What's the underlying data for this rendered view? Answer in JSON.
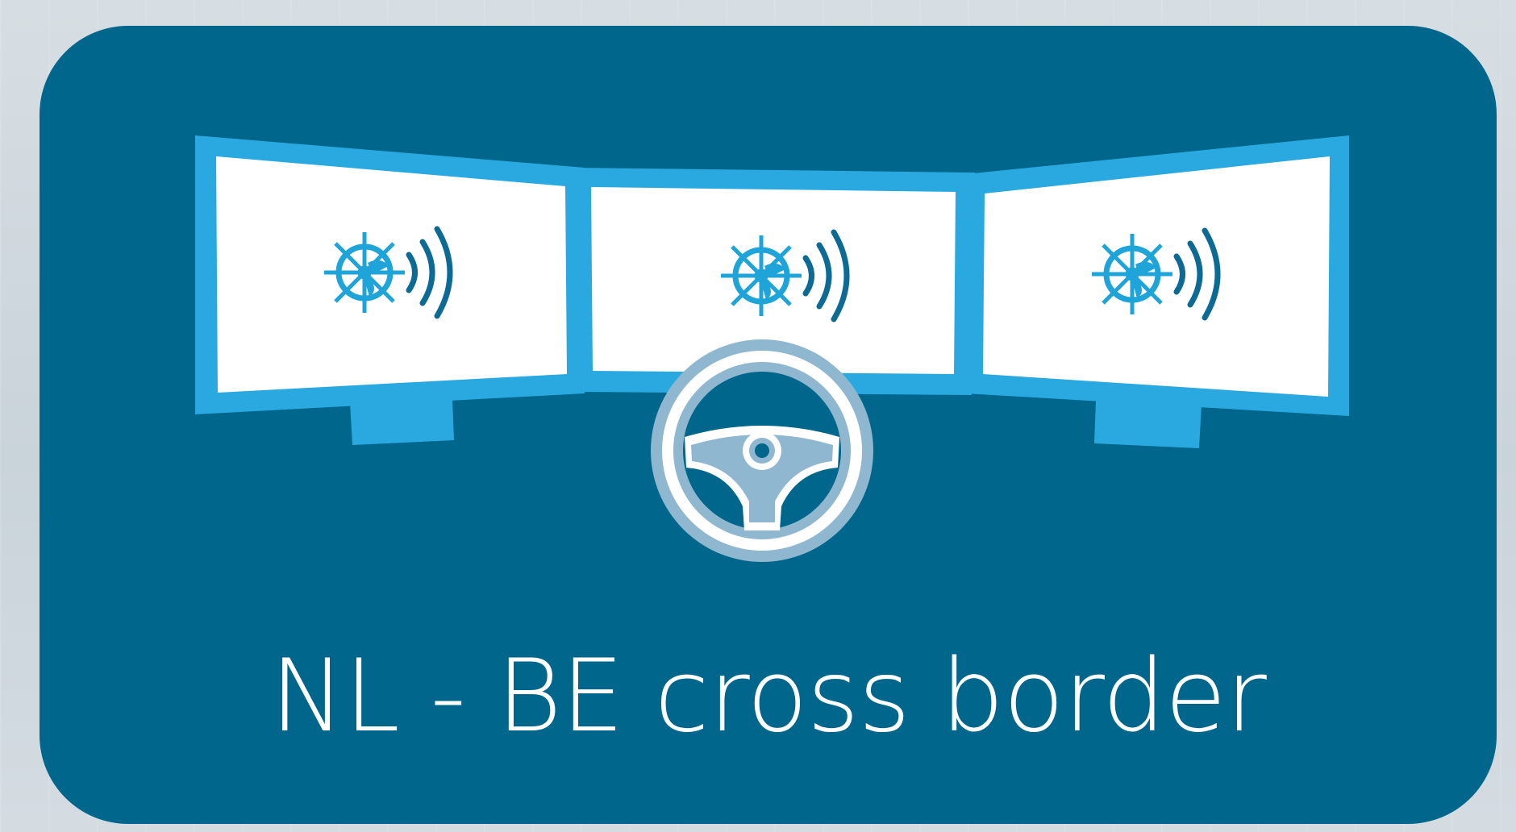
{
  "title": "NL - BE cross border",
  "colors": {
    "background": "#cfd8de",
    "card": "#00668c",
    "monitor_frame": "#2aa9e0",
    "screen": "#ffffff",
    "icon_light": "#1ea4d8",
    "icon_dark": "#0c6a94",
    "steering_ring": "#8fb7cf",
    "steering_fill": "#ffffff",
    "title_text": "#ffffff"
  },
  "icons": {
    "screen_icon": "ship-wheel-signal-icon",
    "center_icon": "steering-wheel-icon"
  },
  "monitors": [
    {
      "name": "left",
      "icon": "ship-wheel-signal-icon"
    },
    {
      "name": "center",
      "icon": "ship-wheel-signal-icon"
    },
    {
      "name": "right",
      "icon": "ship-wheel-signal-icon"
    }
  ]
}
